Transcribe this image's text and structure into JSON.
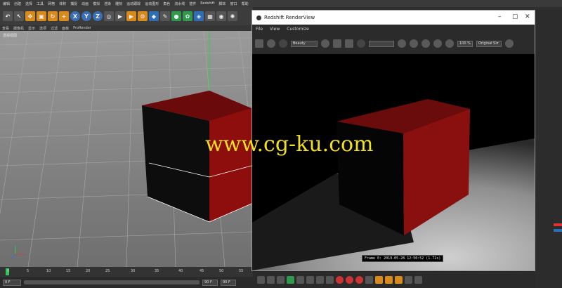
{
  "menubar": {
    "items": [
      "编辑",
      "创建",
      "选择",
      "工具",
      "网格",
      "体积",
      "捕捉",
      "动画",
      "模拟",
      "渲染",
      "雕刻",
      "运动跟踪",
      "运动图形",
      "角色",
      "流水线",
      "插件",
      "Redshift",
      "脚本",
      "窗口",
      "帮助"
    ]
  },
  "toolbar": {
    "axis_x": "X",
    "axis_y": "Y",
    "axis_z": "Z"
  },
  "viewmenu": {
    "items": [
      "查看",
      "摄像机",
      "显示",
      "选项",
      "过滤",
      "面板",
      "ProRender"
    ],
    "view_label": "透视视图"
  },
  "timeline": {
    "ticks": [
      "0",
      "5",
      "10",
      "15",
      "20",
      "25",
      "30",
      "35",
      "40",
      "45",
      "50",
      "55"
    ],
    "start_frame": "0 F",
    "end_frame": "90 F",
    "end_frame2": "90 F"
  },
  "renderview": {
    "title": "Redshift RenderView",
    "menu": [
      "File",
      "View",
      "Customize"
    ],
    "aov_select": "Beauty",
    "zoom": "100 %",
    "mode_select": "Original Siz",
    "frame_info": "Frame 0: 2019-05-28 12:50:52 (1.72s)"
  },
  "watermark": "www.cg-ku.com",
  "colors": {
    "cube_red": "#8e0e0e",
    "cube_dark": "#0d0d0d",
    "grid_bg": "#7a7a7a"
  }
}
